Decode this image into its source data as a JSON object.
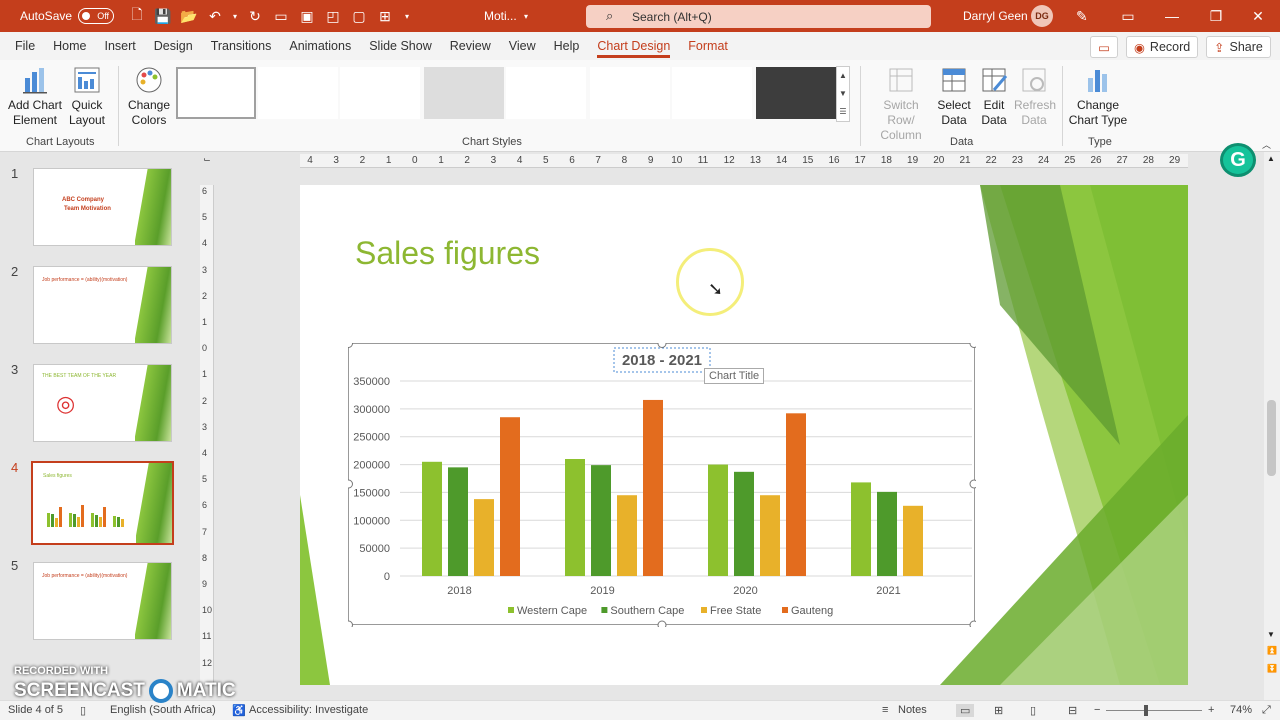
{
  "titlebar": {
    "autosave_label": "AutoSave",
    "autosave_state": "Off",
    "doc_title": "Moti...",
    "search_placeholder": "Search (Alt+Q)",
    "user_name": "Darryl Geen",
    "user_initials": "DG"
  },
  "tabs": [
    "File",
    "Home",
    "Insert",
    "Design",
    "Transitions",
    "Animations",
    "Slide Show",
    "Review",
    "View",
    "Help",
    "Chart Design",
    "Format"
  ],
  "tab_active": "Chart Design",
  "tab_right": {
    "record": "Record",
    "share": "Share"
  },
  "ribbon": {
    "add_chart_element": "Add Chart Element",
    "quick_layout": "Quick Layout",
    "change_colors": "Change Colors",
    "switch_row_col": "Switch Row/ Column",
    "select_data": "Select Data",
    "edit_data": "Edit Data",
    "refresh_data": "Refresh Data",
    "change_chart_type": "Change Chart Type",
    "group_chart_layouts": "Chart Layouts",
    "group_chart_styles": "Chart Styles",
    "group_data": "Data",
    "group_type": "Type"
  },
  "slides": [
    {
      "number": "1",
      "title_line1": "ABC Company",
      "title_line2": "Team Motivation"
    },
    {
      "number": "2",
      "title_line1": "Job performance = (ability)(motivation)"
    },
    {
      "number": "3",
      "title_line1": "THE BEST TEAM OF THE YEAR"
    },
    {
      "number": "4",
      "title_line1": "Sales figures"
    },
    {
      "number": "5",
      "title_line1": "Job performance = (ability)(motivation)"
    }
  ],
  "current_slide": "4",
  "ruler_h": [
    "4",
    "3",
    "2",
    "1",
    "0",
    "1",
    "2",
    "3",
    "4",
    "5",
    "6",
    "7",
    "8",
    "9",
    "10",
    "11",
    "12",
    "13",
    "14",
    "15",
    "16",
    "17",
    "18",
    "19",
    "20",
    "21",
    "22",
    "23",
    "24",
    "25",
    "26",
    "27",
    "28",
    "29"
  ],
  "ruler_v": [
    "6",
    "5",
    "4",
    "3",
    "2",
    "1",
    "0",
    "1",
    "2",
    "3",
    "4",
    "5",
    "6",
    "7",
    "8",
    "9",
    "10",
    "11",
    "12"
  ],
  "slide": {
    "title": "Sales figures",
    "tooltip": "Chart Title"
  },
  "chart_data": {
    "type": "bar",
    "title": "2018 - 2021",
    "categories": [
      "2018",
      "2019",
      "2020",
      "2021"
    ],
    "series": [
      {
        "name": "Western Cape",
        "color": "#8dc12e",
        "values": [
          205000,
          210000,
          200000,
          168000
        ]
      },
      {
        "name": "Southern Cape",
        "color": "#4e9a2b",
        "values": [
          195000,
          199000,
          187000,
          151000
        ]
      },
      {
        "name": "Free State",
        "color": "#e8b12a",
        "values": [
          138000,
          145000,
          145000,
          126000
        ]
      },
      {
        "name": "Gauteng",
        "color": "#e36c1e",
        "values": [
          285000,
          316000,
          292000,
          null
        ]
      }
    ],
    "ylim": [
      0,
      350000
    ],
    "yticks": [
      "350000",
      "300000",
      "250000",
      "200000",
      "150000",
      "100000",
      "50000",
      "0"
    ],
    "grid": true,
    "legend": "bottom"
  },
  "status": {
    "slide_info": "Slide 4 of 5",
    "language": "English (South Africa)",
    "accessibility": "Accessibility: Investigate",
    "notes": "Notes",
    "zoom": "74%"
  },
  "watermark": {
    "line1": "RECORDED WITH",
    "line2": "SCREENCAST",
    "line3": "MATIC"
  },
  "colors": {
    "accent": "#c43e1c",
    "title_green": "#8db732"
  }
}
